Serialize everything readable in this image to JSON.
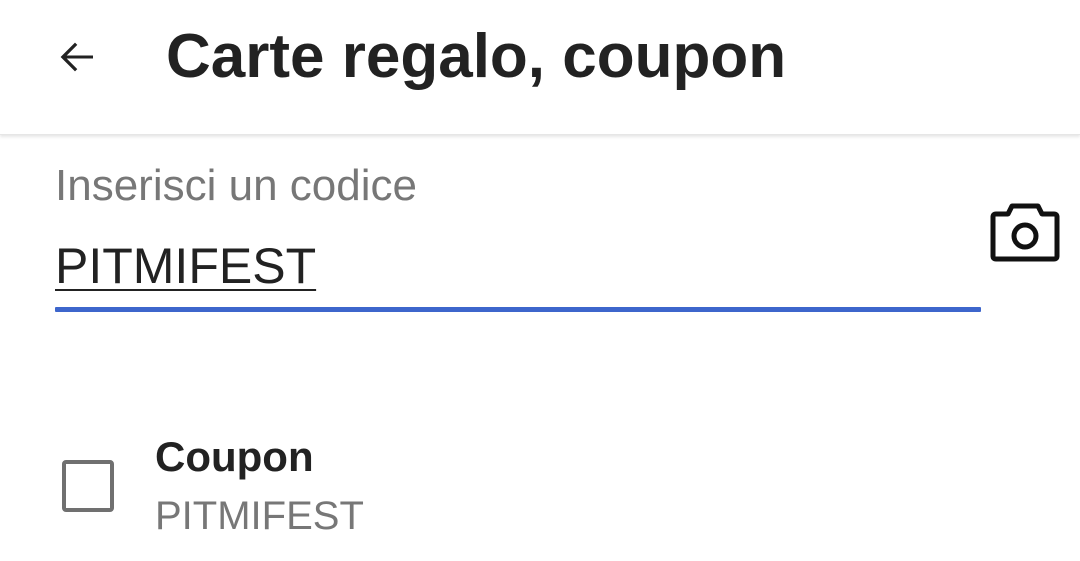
{
  "header": {
    "title": "Carte regalo, coupon",
    "back_icon": "arrow-left-icon"
  },
  "code_field": {
    "label": "Inserisci un codice",
    "value": "PITMIFEST",
    "camera_icon": "camera-icon"
  },
  "coupons": [
    {
      "title": "Coupon",
      "code": "PITMIFEST",
      "checked": false
    }
  ],
  "colors": {
    "accent": "#3d66cc",
    "text_primary": "#222222",
    "text_secondary": "#777777",
    "checkbox_border": "#707070"
  }
}
